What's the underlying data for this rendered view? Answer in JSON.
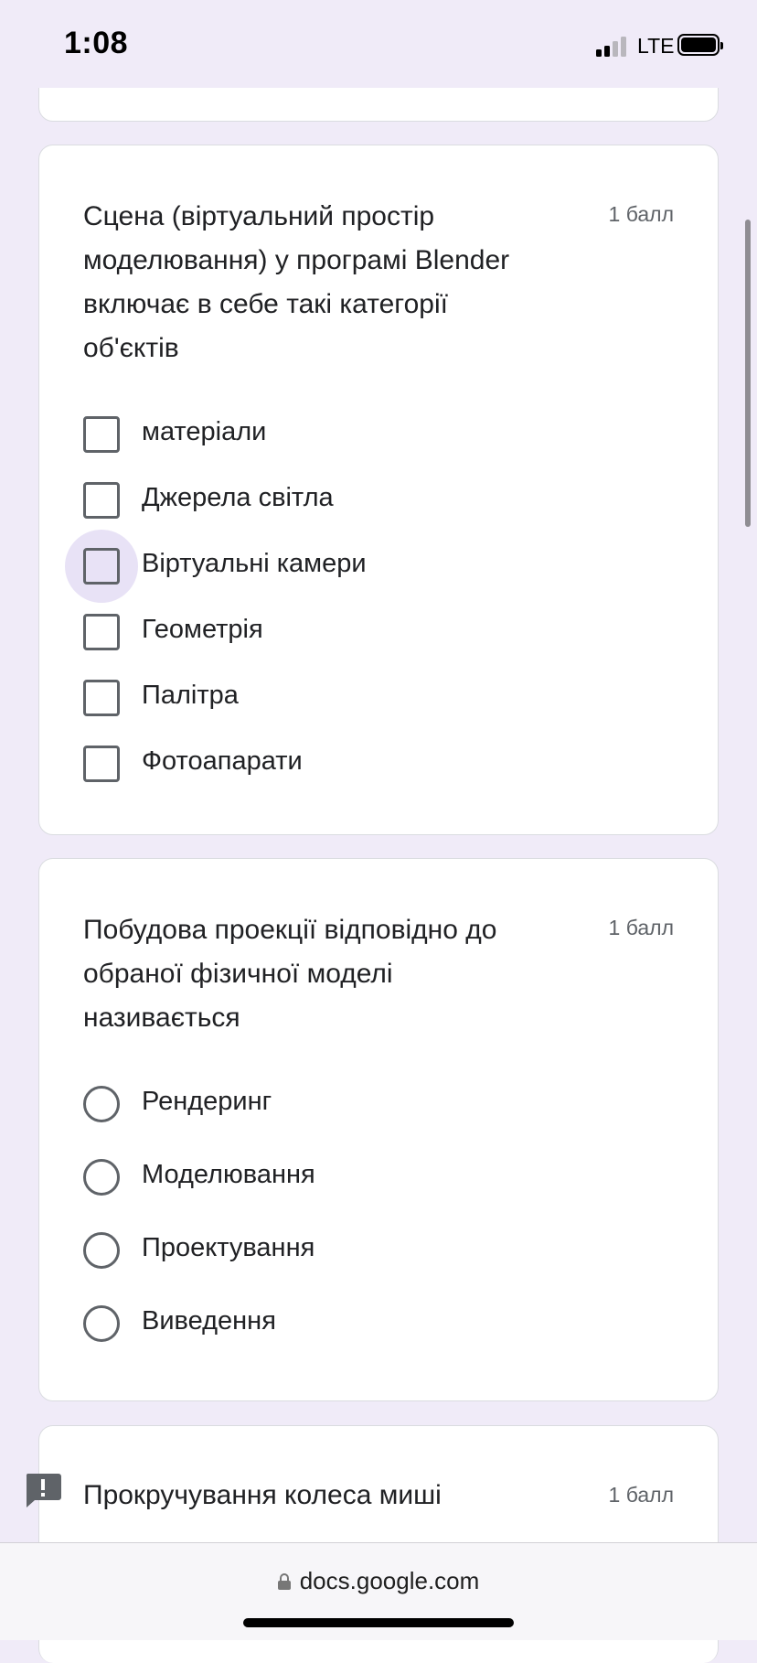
{
  "status_bar": {
    "time": "1:08",
    "network": "LTE"
  },
  "questions": [
    {
      "title": "Сцена (віртуальний простір моделювання) у програмі Blender включає в себе такі категорії об'єктів",
      "points": "1 балл",
      "type": "checkbox",
      "options": [
        "матеріали",
        "Джерела світла",
        "Віртуальні камери",
        "Геометрія",
        "Палітра",
        "Фотоапарати"
      ]
    },
    {
      "title": "Побудова проекції відповідно до обраної фізичної моделі називається",
      "points": "1 балл",
      "type": "radio",
      "options": [
        "Рендеринг",
        "Моделювання",
        "Проектування",
        "Виведення"
      ]
    },
    {
      "title": "Прокручування колеса миші",
      "points": "1 балл"
    }
  ],
  "browser": {
    "url": "docs.google.com"
  },
  "icons": {
    "alert": "alert-icon",
    "lock": "lock-icon"
  },
  "colors": {
    "background": "#f0ebf8",
    "focus_halo": "#e8e2f6",
    "control": "#5f6368"
  }
}
